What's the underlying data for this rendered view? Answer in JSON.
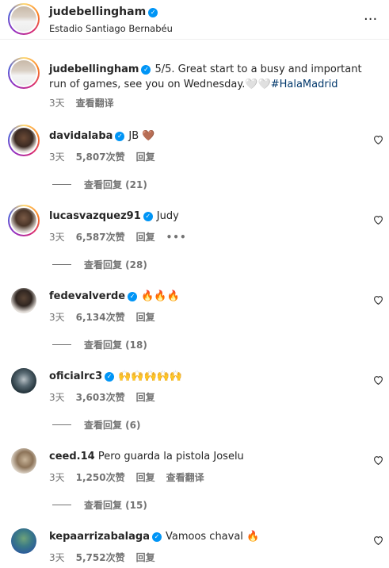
{
  "header": {
    "username": "judebellingham",
    "location": "Estadio Santiago Bernabéu",
    "more": "···"
  },
  "caption": {
    "username": "judebellingham",
    "text": "5/5. Great start to a busy and important run of games, see you on Wednesday.🤍🤍",
    "hashtag": "#HalaMadrid",
    "time": "3天",
    "translate": "查看翻译"
  },
  "comments": [
    {
      "username": "davidalaba",
      "text": "JB 🤎",
      "time": "3天",
      "likes": "5,807次赞",
      "reply": "回复",
      "replies": "查看回复 (21)"
    },
    {
      "username": "lucasvazquez91",
      "text": "Judy",
      "time": "3天",
      "likes": "6,587次赞",
      "reply": "回复",
      "more": "•••",
      "replies": "查看回复 (28)"
    },
    {
      "username": "fedevalverde",
      "text": "🔥🔥🔥",
      "time": "3天",
      "likes": "6,134次赞",
      "reply": "回复",
      "replies": "查看回复 (18)"
    },
    {
      "username": "oficialrc3",
      "text": "🙌🙌🙌🙌🙌",
      "time": "3天",
      "likes": "3,603次赞",
      "reply": "回复",
      "replies": "查看回复 (6)"
    },
    {
      "username": "ceed.14",
      "text": "Pero guarda la pistola Joselu",
      "time": "3天",
      "likes": "1,250次赞",
      "reply": "回复",
      "translate": "查看翻译",
      "replies": "查看回复 (15)"
    },
    {
      "username": "kepaarrizabalaga",
      "text": "Vamoos chaval 🔥",
      "time": "3天",
      "likes": "5,752次赞",
      "reply": "回复"
    }
  ],
  "colors": {
    "badge": "#0095f6",
    "hashtag": "#00376b",
    "muted": "#737373"
  }
}
